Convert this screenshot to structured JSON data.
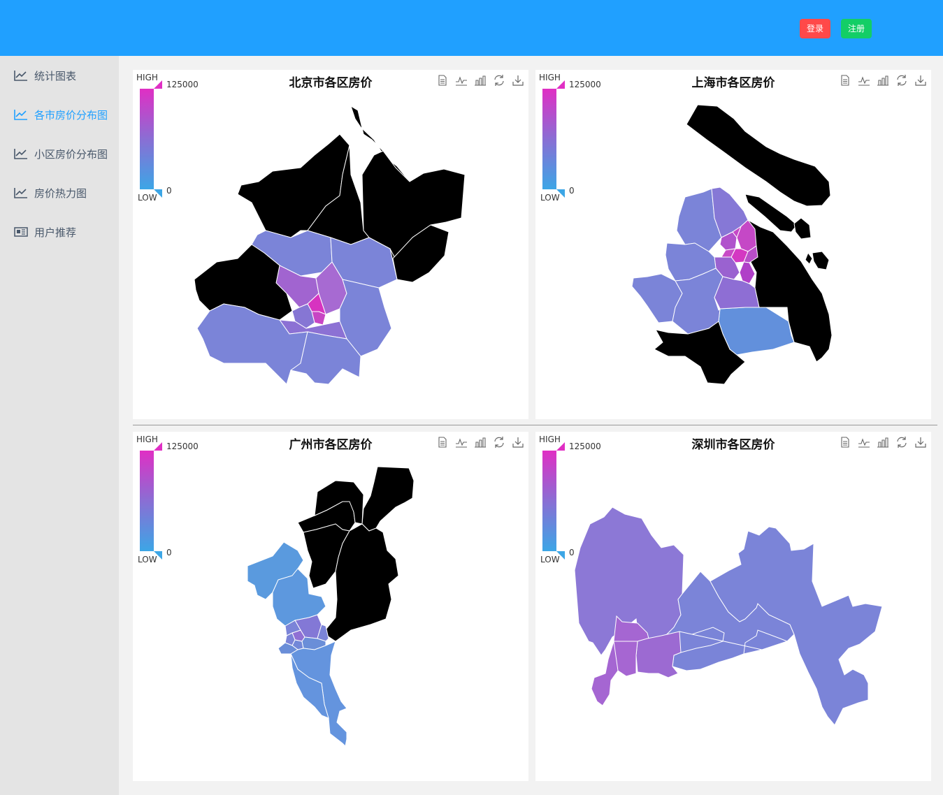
{
  "header": {
    "login_label": "登录",
    "register_label": "注册"
  },
  "sidebar": {
    "items": [
      {
        "label": "统计图表",
        "icon": "line-chart-icon",
        "active": false
      },
      {
        "label": "各市房价分布图",
        "icon": "line-chart-icon",
        "active": true
      },
      {
        "label": "小区房价分布图",
        "icon": "line-chart-icon",
        "active": false
      },
      {
        "label": "房价热力图",
        "icon": "line-chart-icon",
        "active": false
      },
      {
        "label": "用户推荐",
        "icon": "newspaper-icon",
        "active": false
      }
    ]
  },
  "visual_map": {
    "high_label": "HIGH",
    "low_label": "LOW",
    "max": "125000",
    "min": "0",
    "color_high": "#e02fc4",
    "color_low": "#3ca6e6"
  },
  "toolbox": [
    "data-view-icon",
    "line-chart-icon",
    "bar-chart-icon",
    "restore-icon",
    "download-icon"
  ],
  "panels": [
    {
      "title": "北京市各区房价"
    },
    {
      "title": "上海市各区房价"
    },
    {
      "title": "广州市各区房价"
    },
    {
      "title": "深圳市各区房价"
    }
  ],
  "colors": {
    "accent": "#20a0ff",
    "login": "#ff4949",
    "register": "#13ce66",
    "no_data": "#000000"
  }
}
